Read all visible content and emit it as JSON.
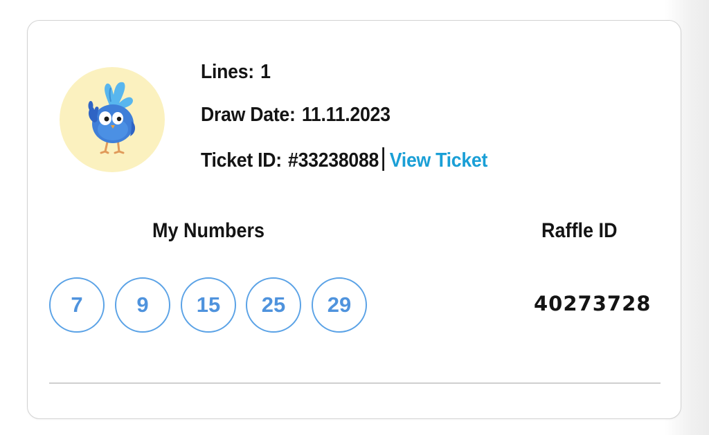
{
  "ticket": {
    "lines_label": "Lines:",
    "lines_value": "1",
    "draw_date_label": "Draw Date:",
    "draw_date_value": "11.11.2023",
    "ticket_id_label": "Ticket ID:",
    "ticket_id_value": "#33238088",
    "view_ticket_link": "View Ticket"
  },
  "numbers_section": {
    "heading": "My Numbers",
    "numbers": [
      "7",
      "9",
      "15",
      "25",
      "29"
    ]
  },
  "raffle_section": {
    "heading": "Raffle ID",
    "value": "40273728"
  },
  "avatar": {
    "icon": "bird-mascot-thumbs-up-icon"
  },
  "colors": {
    "link": "#1a9fd6",
    "ball_border": "#5aa2e6",
    "ball_text": "#4f93dd",
    "avatar_bg": "#fbf1bf",
    "text": "#141414"
  }
}
